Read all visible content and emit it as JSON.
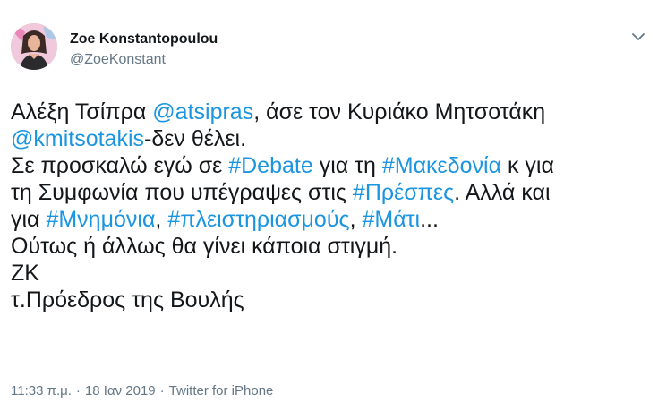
{
  "author": {
    "display_name": "Zoe Konstantopoulou",
    "handle": "@ZoeKonstant"
  },
  "menu": {
    "icon": "chevron-down-icon"
  },
  "tweet": {
    "lines": [
      [
        {
          "t": "Αλέξη Τσίπρα ",
          "link": false
        },
        {
          "t": "@atsipras",
          "link": true
        },
        {
          "t": ", άσε τον Κυριάκο Μητσοτάκη",
          "link": false
        }
      ],
      [
        {
          "t": "@kmitsotakis",
          "link": true
        },
        {
          "t": "-δεν θέλει.",
          "link": false
        }
      ],
      [
        {
          "t": "Σε προσκαλώ εγώ σε ",
          "link": false
        },
        {
          "t": "#Debate",
          "link": true
        },
        {
          "t": " για τη ",
          "link": false
        },
        {
          "t": "#Μακεδονία",
          "link": true
        },
        {
          "t": " κ για",
          "link": false
        }
      ],
      [
        {
          "t": "τη Συμφωνία που υπέγραψες στις ",
          "link": false
        },
        {
          "t": "#Πρέσπες",
          "link": true
        },
        {
          "t": ". Αλλά και",
          "link": false
        }
      ],
      [
        {
          "t": "για ",
          "link": false
        },
        {
          "t": "#Μνημόνια",
          "link": true
        },
        {
          "t": ", ",
          "link": false
        },
        {
          "t": "#πλειστηριασμούς",
          "link": true
        },
        {
          "t": ", ",
          "link": false
        },
        {
          "t": "#Μάτι",
          "link": true
        },
        {
          "t": "...",
          "link": false
        }
      ],
      [
        {
          "t": "Ούτως ή άλλως θα γίνει κάποια στιγμή.",
          "link": false
        }
      ],
      [
        {
          "t": "ΖΚ",
          "link": false
        }
      ],
      [
        {
          "t": "τ.Πρόεδρος της Βουλής",
          "link": false
        }
      ]
    ]
  },
  "footer": {
    "time": "11:33 π.μ.",
    "separator": "·",
    "date": "18 Ιαν 2019",
    "source": "Twitter for iPhone"
  },
  "colors": {
    "link": "#1b95e0",
    "text": "#14171a",
    "muted": "#657786"
  }
}
